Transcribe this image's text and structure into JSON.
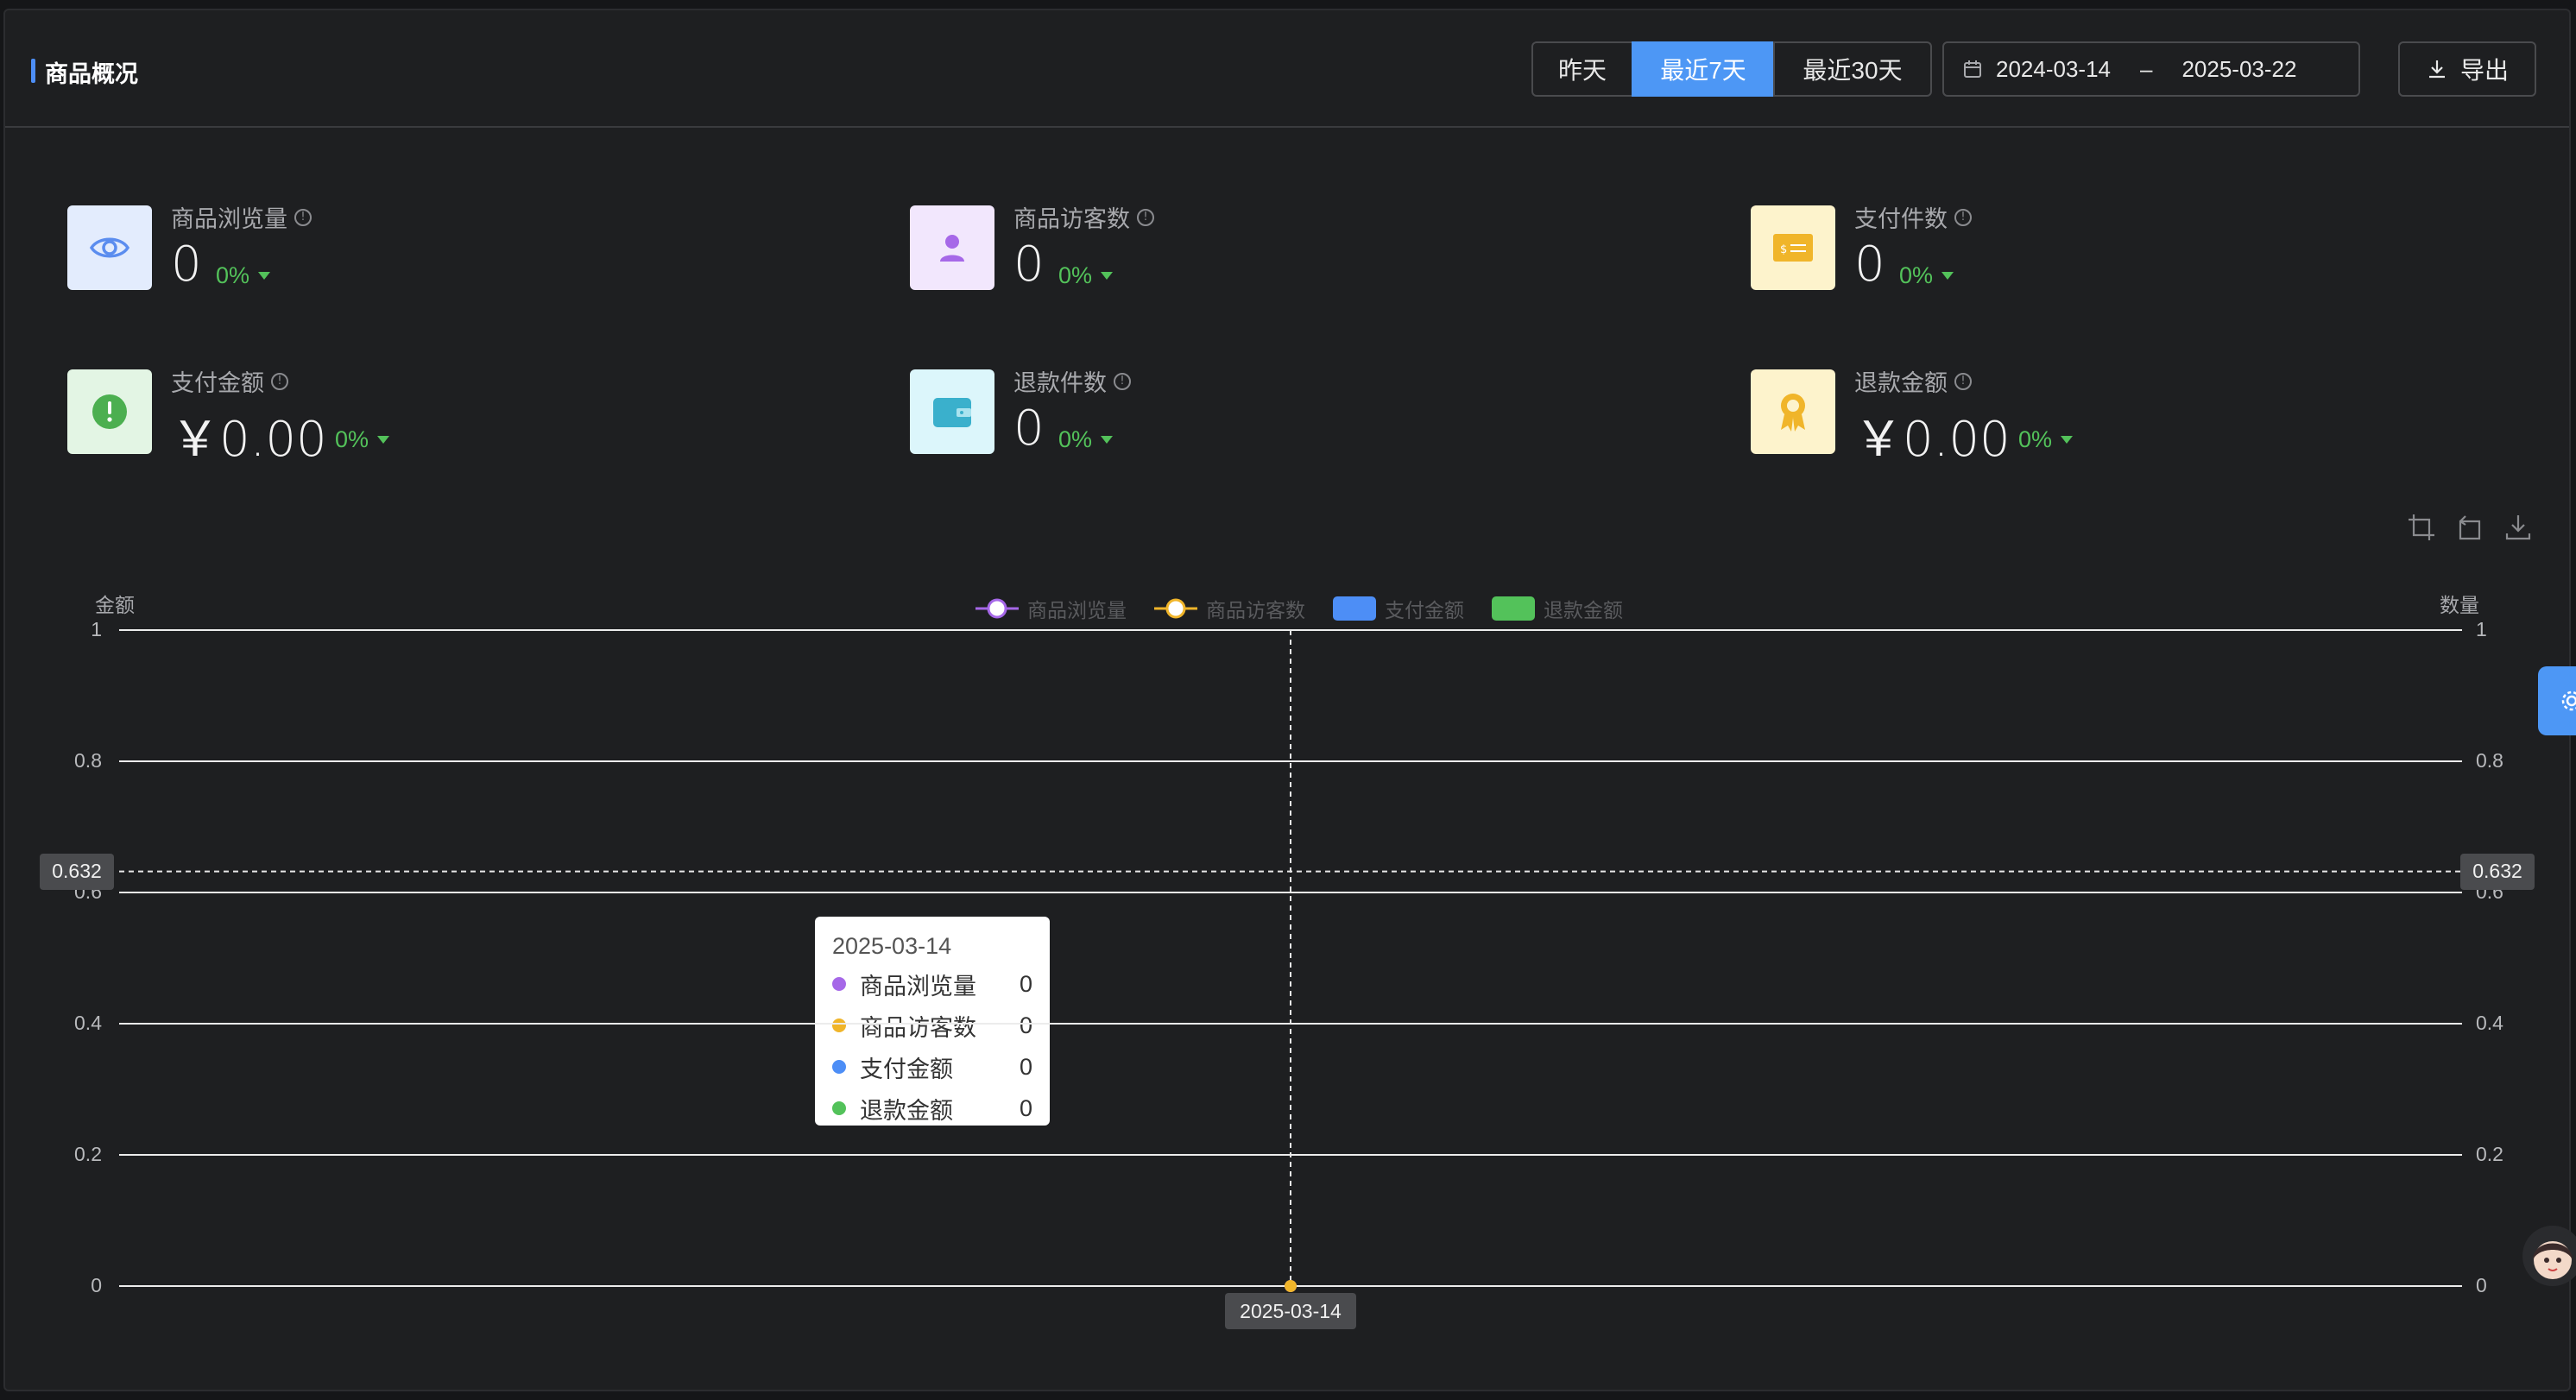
{
  "header": {
    "title": "商品概况",
    "range_buttons": [
      "昨天",
      "最近7天",
      "最近30天"
    ],
    "active_range": "最近7天",
    "date_start": "2024-03-14",
    "date_sep": "–",
    "date_end": "2025-03-22",
    "export_label": "导出"
  },
  "kpis": [
    {
      "label": "商品浏览量",
      "value": "0",
      "change": "0%",
      "icon": "eye-icon",
      "color": "#5b8def",
      "bg": "#e3ecfd"
    },
    {
      "label": "商品访客数",
      "value": "0",
      "change": "0%",
      "icon": "user-icon",
      "color": "#a668e8",
      "bg": "#f2e7fd"
    },
    {
      "label": "支付件数",
      "value": "0",
      "change": "0%",
      "icon": "payment-card-icon",
      "color": "#f0b52a",
      "bg": "#fdf3cc"
    },
    {
      "label": "支付金额",
      "value": "￥0.00",
      "change": "0%",
      "icon": "exclamation-icon",
      "color": "#4caf50",
      "bg": "#e3f5e4"
    },
    {
      "label": "退款件数",
      "value": "0",
      "change": "0%",
      "icon": "wallet-icon",
      "color": "#3ab0cc",
      "bg": "#dcf6fb"
    },
    {
      "label": "退款金额",
      "value": "￥0.00",
      "change": "0%",
      "icon": "award-icon",
      "color": "#f0b52a",
      "bg": "#fdf3cc"
    }
  ],
  "chart_data": {
    "type": "line",
    "left_axis_title": "金额",
    "right_axis_title": "数量",
    "y_ticks": [
      "1",
      "0.8",
      "0.6",
      "0.4",
      "0.2",
      "0"
    ],
    "ylim": [
      0,
      1
    ],
    "x": [
      "2025-03-14"
    ],
    "series": [
      {
        "name": "商品浏览量",
        "kind": "line",
        "color": "#a668e8",
        "values": [
          0
        ]
      },
      {
        "name": "商品访客数",
        "kind": "line",
        "color": "#f0b52a",
        "values": [
          0
        ]
      },
      {
        "name": "支付金额",
        "kind": "bar",
        "color": "#4d8ef6",
        "values": [
          0
        ]
      },
      {
        "name": "退款金额",
        "kind": "bar",
        "color": "#53c25a",
        "values": [
          0
        ]
      }
    ],
    "crosshair_y": "0.632",
    "crosshair_x": "2025-03-14",
    "tooltip": {
      "date": "2025-03-14",
      "rows": [
        {
          "name": "商品浏览量",
          "value": "0",
          "color": "#a668e8"
        },
        {
          "name": "商品访客数",
          "value": "0",
          "color": "#f0b52a"
        },
        {
          "name": "支付金额",
          "value": "0",
          "color": "#4d8ef6"
        },
        {
          "name": "退款金额",
          "value": "0",
          "color": "#53c25a"
        }
      ]
    },
    "grid": true,
    "legend_position": "top-center"
  }
}
